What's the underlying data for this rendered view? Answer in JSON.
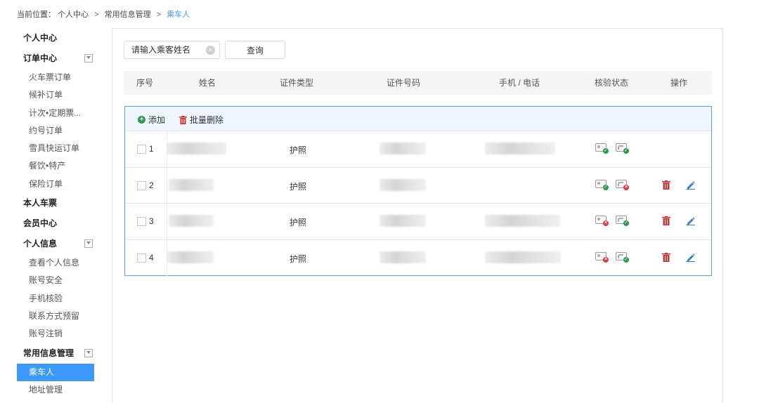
{
  "breadcrumb": {
    "prefix": "当前位置：",
    "items": [
      "个人中心",
      "常用信息管理",
      "乘车人"
    ],
    "separator": ">"
  },
  "sidebar": {
    "sections": [
      {
        "label": "个人中心",
        "collapsible": false,
        "items": []
      },
      {
        "label": "订单中心",
        "collapsible": true,
        "items": [
          "火车票订单",
          "候补订单",
          "计次•定期票...",
          "约号订单",
          "雪具快运订单",
          "餐饮•特产",
          "保险订单"
        ]
      },
      {
        "label": "本人车票",
        "collapsible": false,
        "items": []
      },
      {
        "label": "会员中心",
        "collapsible": false,
        "items": []
      },
      {
        "label": "个人信息",
        "collapsible": true,
        "items": [
          "查看个人信息",
          "账号安全",
          "手机核验",
          "联系方式预留",
          "账号注销"
        ]
      },
      {
        "label": "常用信息管理",
        "collapsible": true,
        "items": [
          "乘车人",
          "地址管理"
        ]
      }
    ],
    "active_item": "乘车人"
  },
  "search": {
    "placeholder": "请输入乘客姓名",
    "button_label": "查询"
  },
  "table": {
    "headers": [
      "序号",
      "姓名",
      "证件类型",
      "证件号码",
      "手机 / 电话",
      "核验状态",
      "操作"
    ],
    "toolbar": {
      "add_label": "添加",
      "batch_delete_label": "批量删除"
    },
    "rows": [
      {
        "index": "1",
        "doc_type": "护照",
        "id_status": "verified",
        "phone_status": "verified",
        "has_actions": false
      },
      {
        "index": "2",
        "doc_type": "护照",
        "id_status": "verified",
        "phone_status": "failed",
        "has_actions": true
      },
      {
        "index": "3",
        "doc_type": "护照",
        "id_status": "failed",
        "phone_status": "verified",
        "has_actions": true
      },
      {
        "index": "4",
        "doc_type": "护照",
        "id_status": "failed",
        "phone_status": "verified",
        "has_actions": true
      }
    ]
  },
  "colors": {
    "accent": "#3b99fc",
    "verified": "#2e9a4f",
    "failed": "#e13b3b",
    "delete": "#d0312d",
    "edit": "#2f7fd8"
  },
  "icons": {
    "add": "plus-circle-icon",
    "delete": "trash-icon",
    "edit": "pencil-icon",
    "id_verify": "id-card-icon",
    "phone_verify": "phone-icon",
    "clear": "clear-icon",
    "toggle": "chevron-down-icon"
  }
}
